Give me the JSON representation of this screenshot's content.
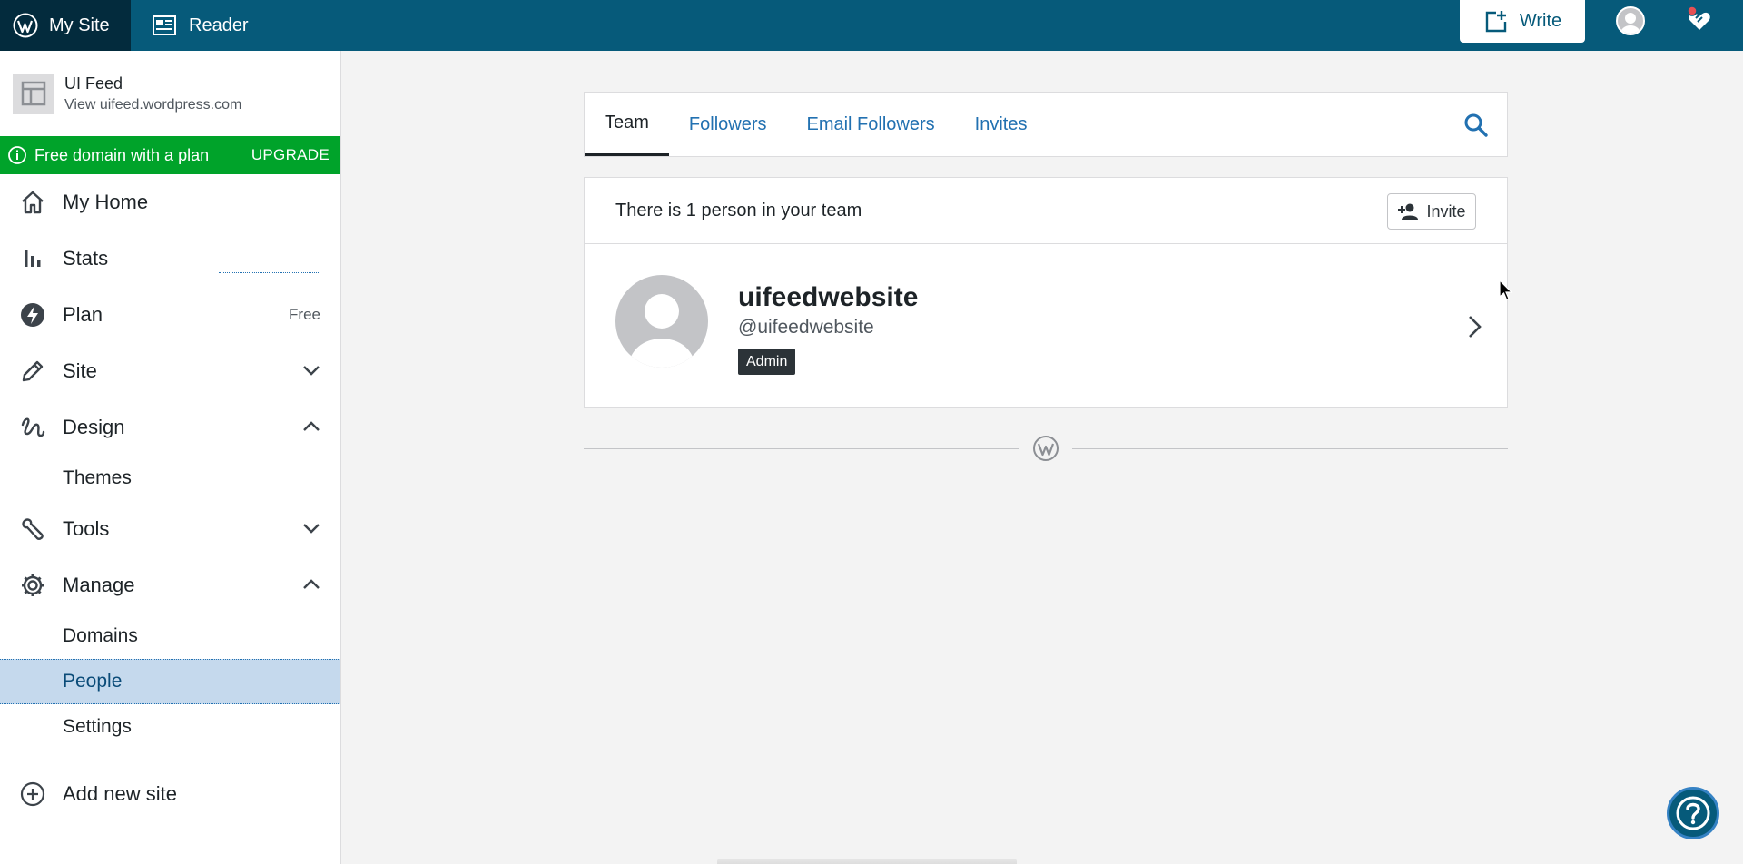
{
  "topbar": {
    "my_site_label": "My Site",
    "reader_label": "Reader",
    "write_label": "Write"
  },
  "sidebar": {
    "site": {
      "name": "UI Feed",
      "url": "View uifeed.wordpress.com"
    },
    "upsell": {
      "text": "Free domain with a plan",
      "action": "UPGRADE"
    },
    "items": [
      {
        "label": "My Home"
      },
      {
        "label": "Stats"
      },
      {
        "label": "Plan",
        "badge": "Free"
      },
      {
        "label": "Site"
      },
      {
        "label": "Design"
      },
      {
        "label": "Tools"
      },
      {
        "label": "Manage"
      },
      {
        "label": "Add new site"
      }
    ],
    "design_sub": [
      {
        "label": "Themes"
      }
    ],
    "manage_sub": [
      {
        "label": "Domains"
      },
      {
        "label": "People"
      },
      {
        "label": "Settings"
      }
    ]
  },
  "tabs": [
    {
      "label": "Team"
    },
    {
      "label": "Followers"
    },
    {
      "label": "Email Followers"
    },
    {
      "label": "Invites"
    }
  ],
  "team": {
    "summary": "There is 1 person in your team",
    "invite_label": "Invite",
    "person": {
      "name": "uifeedwebsite",
      "handle": "@uifeedwebsite",
      "role": "Admin"
    }
  },
  "colors": {
    "masterbar": "#065a7a",
    "masterbar_dark": "#032b3d",
    "upsell_green": "#00a32a",
    "link_blue": "#2271b1",
    "active_highlight": "#c5d9ed"
  }
}
